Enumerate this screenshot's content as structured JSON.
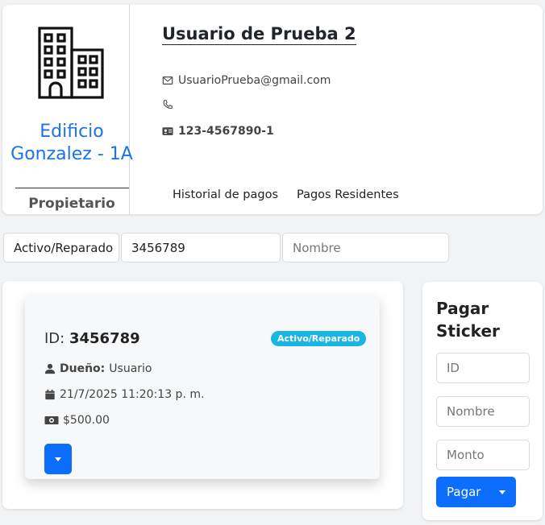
{
  "profile": {
    "building_name": "Edificio Gonzalez - 1A",
    "role": "Propietario",
    "user_name": "Usuario de Prueba 2",
    "email": "UsuarioPrueba@gmail.com",
    "phone": "",
    "id_number": "123-4567890-1",
    "icons": {
      "building": "building-icon",
      "email": "envelope-icon",
      "phone": "phone-icon",
      "id": "id-card-icon"
    }
  },
  "tabs": [
    {
      "label": "Historial de pagos"
    },
    {
      "label": "Pagos Residentes"
    }
  ],
  "filters": {
    "status_value": "Activo/Reparado",
    "id_value": "3456789",
    "name_placeholder": "Nombre"
  },
  "sticker": {
    "id_label": "ID:",
    "id_value": "3456789",
    "status": "Activo/Reparado",
    "owner_label": "Dueño:",
    "owner_value": "Usuario",
    "date": "21/7/2025 11:20:13 p. m.",
    "amount": "$500.00"
  },
  "pay_form": {
    "title": "Pagar Sticker",
    "id_placeholder": "ID",
    "name_placeholder": "Nombre",
    "amount_placeholder": "Monto",
    "submit_label": "Pagar"
  },
  "colors": {
    "accent": "#0d6efd",
    "building_name": "#1a73e8",
    "badge": "#1ab6e3",
    "background": "#f2f3f5"
  }
}
